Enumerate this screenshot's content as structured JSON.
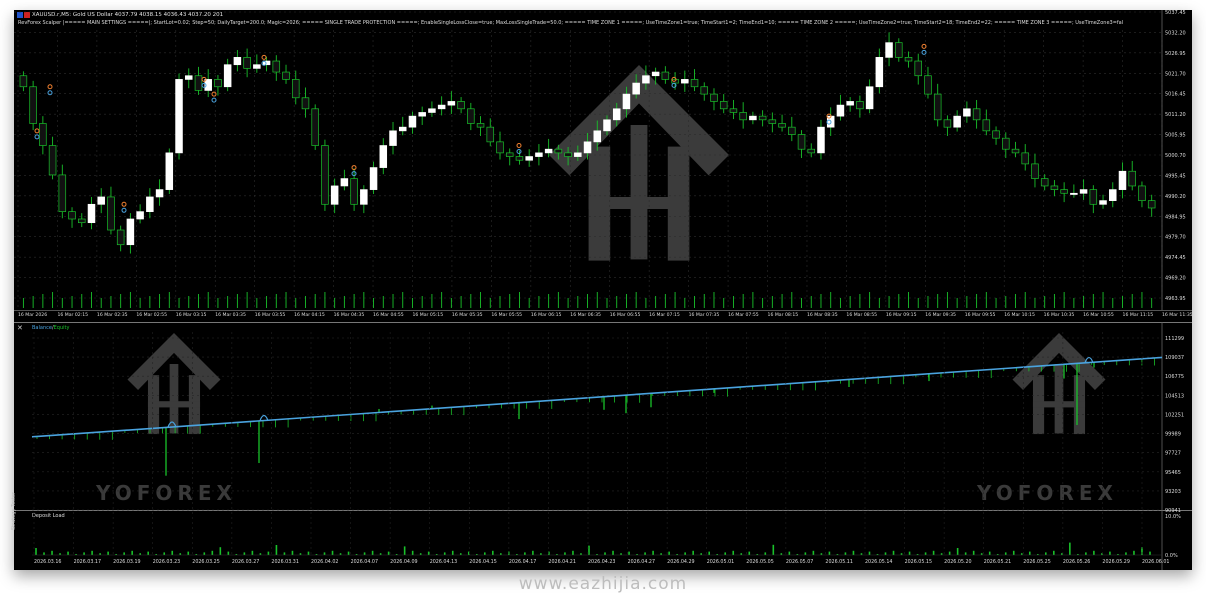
{
  "header": {
    "symbol_line": "XAUUSD.r,M5:  Gold US Dollar  4037.79 4038.15 4036.43 4037.20  201",
    "settings_line": "RevForex Scalper |===== MAIN SETTINGS =====|; StartLot=0.02; Step=50; DailyTarget=200.0; Magic=2026; ===== SINGLE TRADE PROTECTION =====; EnableSingleLossClose=true; MaxLossSingleTrade=50.0; ===== TIME ZONE 1 =====; UseTimeZone1=true; TimeStart1=2; TimeEnd1=10; ===== TIME ZONE 2 =====; UseTimeZone2=true; TimeStart2=18; TimeEnd2=22; ===== TIME ZONE 3 =====; UseTimeZone3=fal"
  },
  "price_axis": [
    "5037.45",
    "5032.20",
    "5026.95",
    "5021.70",
    "5016.45",
    "5011.20",
    "5005.95",
    "5000.70",
    "4995.45",
    "4990.20",
    "4984.95",
    "4979.70",
    "4974.45",
    "4969.20",
    "4963.95"
  ],
  "time_axis": [
    "16 Mar 2026",
    "16 Mar 02:15",
    "16 Mar 02:35",
    "16 Mar 02:55",
    "16 Mar 03:15",
    "16 Mar 03:35",
    "16 Mar 03:55",
    "16 Mar 04:15",
    "16 Mar 04:35",
    "16 Mar 04:55",
    "16 Mar 05:15",
    "16 Mar 05:35",
    "16 Mar 05:55",
    "16 Mar 06:15",
    "16 Mar 06:35",
    "16 Mar 06:55",
    "16 Mar 07:15",
    "16 Mar 07:35",
    "16 Mar 07:55",
    "16 Mar 08:15",
    "16 Mar 08:35",
    "16 Mar 08:55",
    "16 Mar 09:15",
    "16 Mar 09:35",
    "16 Mar 09:55",
    "16 Mar 10:15",
    "16 Mar 10:35",
    "16 Mar 10:55",
    "16 Mar 11:15",
    "16 Mar 11:35"
  ],
  "equity_panel": {
    "title_balance": "Balance",
    "title_sep": "/",
    "title_equity": "Equity",
    "axis": [
      "111299",
      "109037",
      "106775",
      "104513",
      "102251",
      "99989",
      "97727",
      "95465",
      "93203",
      "90941"
    ],
    "balance_color": "#4aa3df",
    "equity_color": "#19c12a"
  },
  "deposit_panel": {
    "title": "Deposit Load",
    "axis": [
      "10.0%",
      "0.0%"
    ]
  },
  "date_axis": [
    "2026.03.16",
    "2026.03.17",
    "2026.03.19",
    "2026.03.23",
    "2026.03.25",
    "2026.03.27",
    "2026.03.31",
    "2026.04.02",
    "2026.04.07",
    "2026.04.09",
    "2026.04.13",
    "2026.04.15",
    "2026.04.17",
    "2026.04.21",
    "2026.04.23",
    "2026.04.27",
    "2026.04.29",
    "2026.05.01",
    "2026.05.05",
    "2026.05.07",
    "2026.05.11",
    "2026.05.14",
    "2026.05.15",
    "2026.05.20",
    "2026.05.21",
    "2026.05.25",
    "2026.05.26",
    "2026.05.29",
    "2026.06.01"
  ],
  "side_label": "Strategy Tester",
  "watermark": "YOFOREX",
  "footer_url": "www.eazhijia.com",
  "colors": {
    "background": "#000000",
    "bull_candle": "#ffffff",
    "bear_candle": "#111111",
    "wick": "#19c12a",
    "volume": "#19c12a"
  },
  "chart_data": [
    {
      "type": "candlestick",
      "title": "XAUUSD.r,M5",
      "y_range": [
        4963.95,
        5037.45
      ],
      "candles_approx_close": [
        5022,
        5012,
        5006,
        4998,
        4988,
        4986,
        4985,
        4990,
        4992,
        4983,
        4979,
        4986,
        4988,
        4992,
        4994,
        5004,
        5024,
        5025,
        5021,
        5024,
        5022,
        5028,
        5030,
        5027,
        5028,
        5029,
        5026,
        5024,
        5019,
        5016,
        5006,
        4990,
        4995,
        4997,
        4990,
        4994,
        5000,
        5006,
        5010,
        5011,
        5014,
        5015,
        5016,
        5017,
        5018,
        5016,
        5012,
        5011,
        5007,
        5004,
        5003,
        5002,
        5003,
        5004,
        5005,
        5004,
        5003,
        5004,
        5007,
        5010,
        5013,
        5016,
        5020,
        5023,
        5025,
        5026,
        5024,
        5023,
        5024,
        5022,
        5020,
        5018,
        5016,
        5015,
        5013,
        5014,
        5013,
        5012,
        5011,
        5009,
        5005,
        5004,
        5011,
        5014,
        5017,
        5018,
        5016,
        5022,
        5030,
        5034,
        5030,
        5029,
        5025,
        5020,
        5013,
        5011,
        5014,
        5016,
        5013,
        5010,
        5008,
        5005,
        5004,
        5001,
        4997,
        4995,
        4994,
        4993,
        4993,
        4994,
        4990,
        4991,
        4994,
        4999,
        4995,
        4991,
        4989
      ]
    },
    {
      "type": "line",
      "title": "Balance / Equity",
      "y_range": [
        90941,
        111299
      ],
      "series": [
        {
          "name": "Balance",
          "start": 99600,
          "end": 109000
        },
        {
          "name": "Equity",
          "start": 99600,
          "end": 109000
        }
      ]
    },
    {
      "type": "area",
      "title": "Deposit Load",
      "y_range": [
        0,
        10
      ]
    }
  ]
}
